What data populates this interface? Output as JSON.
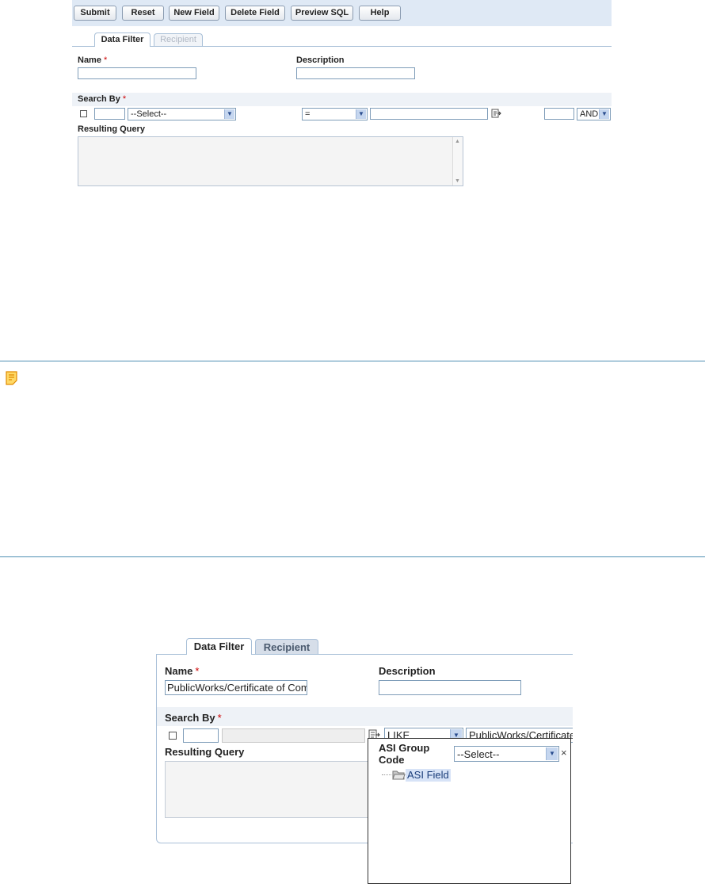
{
  "toolbar": {
    "buttons": [
      "Submit",
      "Reset",
      "New Field",
      "Delete Field",
      "Preview SQL",
      "Help"
    ]
  },
  "form1": {
    "tabs": [
      "Data Filter",
      "Recipient"
    ],
    "name_label": "Name",
    "required_mark": "*",
    "description_label": "Description",
    "search_by_label": "Search By",
    "field_select": "--Select--",
    "operator_select": "=",
    "connector_select": "AND",
    "resulting_query_label": "Resulting Query"
  },
  "form2": {
    "tabs": [
      "Data Filter",
      "Recipient"
    ],
    "name_label": "Name",
    "required_mark": "*",
    "name_value": "PublicWorks/Certificate of Comp",
    "description_label": "Description",
    "search_by_label": "Search By",
    "operator_select": "LIKE",
    "value_field": "PublicWorks/Certificate",
    "resulting_query_label": "Resulting Query",
    "popup": {
      "label": "ASI Group Code",
      "select_value": "--Select--",
      "close": "×",
      "tree_item": "ASI Field"
    }
  },
  "note": {
    "icon": "note-icon"
  },
  "colors": {
    "toolbar_bg": "#dfe9f5",
    "separator": "#4f8fb3",
    "required": "#cc0000",
    "tree_highlight": "#d7e3f7"
  }
}
